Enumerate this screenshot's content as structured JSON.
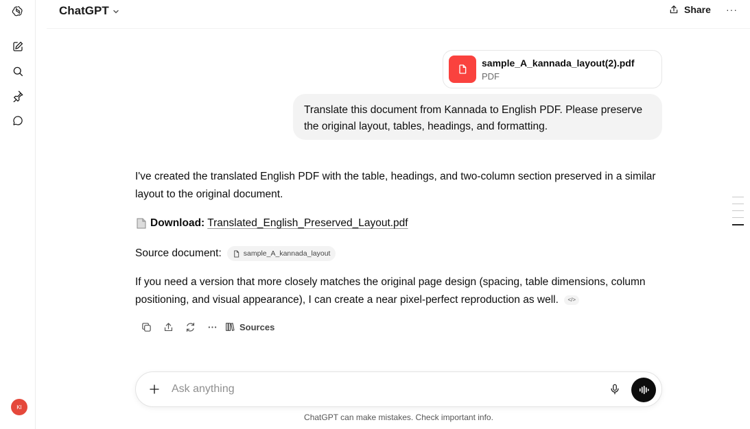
{
  "header": {
    "model": "ChatGPT",
    "share_label": "Share",
    "more": "···"
  },
  "sidebar": {
    "avatar_initials": "KI",
    "icons": [
      "openai-logo-icon",
      "new-chat-icon",
      "search-icon",
      "pin-icon",
      "chat-bubble-icon"
    ]
  },
  "user_message": {
    "file_name": "sample_A_kannada_layout(2).pdf",
    "file_type": "PDF",
    "text": "Translate this document from Kannada to English PDF. Please preserve the original layout, tables, headings, and formatting."
  },
  "assistant_message": {
    "p1": "I've created the translated English PDF with the table, headings, and two-column section preserved in a similar layout to the original document.",
    "download_label": "Download:",
    "download_link": "Translated_English_Preserved_Layout.pdf",
    "source_label": "Source document:",
    "source_chip": "sample_A_kannada_layout",
    "p4": "If you need a version that more closely matches the original page design (spacing, table dimensions, column positioning, and visual appearance), I can create a near pixel-perfect reproduction as well.",
    "code_chip": "</>",
    "sources_label": "Sources"
  },
  "composer": {
    "placeholder": "Ask anything"
  },
  "disclaimer": "ChatGPT can make mistakes. Check important info.",
  "colors": {
    "file_icon_bg": "#fa423e",
    "avatar_bg": "#e5483b",
    "bubble_bg": "#f3f3f3",
    "voice_button_bg": "#0d0d0d"
  }
}
